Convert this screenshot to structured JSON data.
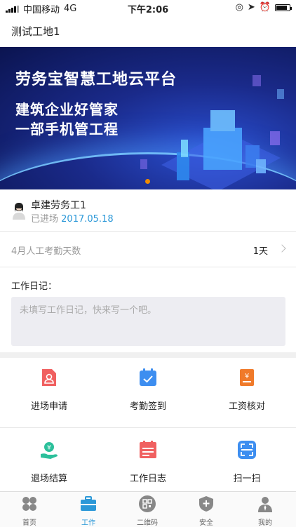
{
  "status_bar": {
    "carrier": "中国移动",
    "network": "4G",
    "time": "下午2:06"
  },
  "header": {
    "title": "测试工地1"
  },
  "banner": {
    "line1": "劳务宝智慧工地云平台",
    "line2": "建筑企业好管家",
    "line3": "一部手机管工程"
  },
  "user": {
    "name": "卓建劳务工1",
    "entry_label": "已进场",
    "entry_date": "2017.05.18"
  },
  "attendance": {
    "label": "4月人工考勤天数",
    "value": "1天"
  },
  "diary": {
    "label": "工作日记：",
    "placeholder": "未填写工作日记，快来写一个吧。"
  },
  "functions": [
    {
      "label": "进场申请",
      "icon": "entry-application-icon",
      "color": "#f06060"
    },
    {
      "label": "考勤签到",
      "icon": "attendance-checkin-icon",
      "color": "#3d8ef0"
    },
    {
      "label": "工资核对",
      "icon": "salary-check-icon",
      "color": "#f07a2a"
    },
    {
      "label": "退场结算",
      "icon": "exit-settlement-icon",
      "color": "#2cc09b"
    },
    {
      "label": "工作日志",
      "icon": "work-log-icon",
      "color": "#f06060"
    },
    {
      "label": "扫一扫",
      "icon": "scan-icon",
      "color": "#3d8ef0"
    }
  ],
  "tabs": [
    {
      "label": "首页",
      "icon": "home-grid-icon"
    },
    {
      "label": "工作",
      "icon": "briefcase-icon",
      "active": true
    },
    {
      "label": "二维码",
      "icon": "qr-code-icon"
    },
    {
      "label": "安全",
      "icon": "shield-icon"
    },
    {
      "label": "我的",
      "icon": "person-icon"
    }
  ],
  "colors": {
    "accent": "#2b98d8",
    "banner_bg": "#1a2a8a",
    "active_tab": "#2b98d8"
  }
}
